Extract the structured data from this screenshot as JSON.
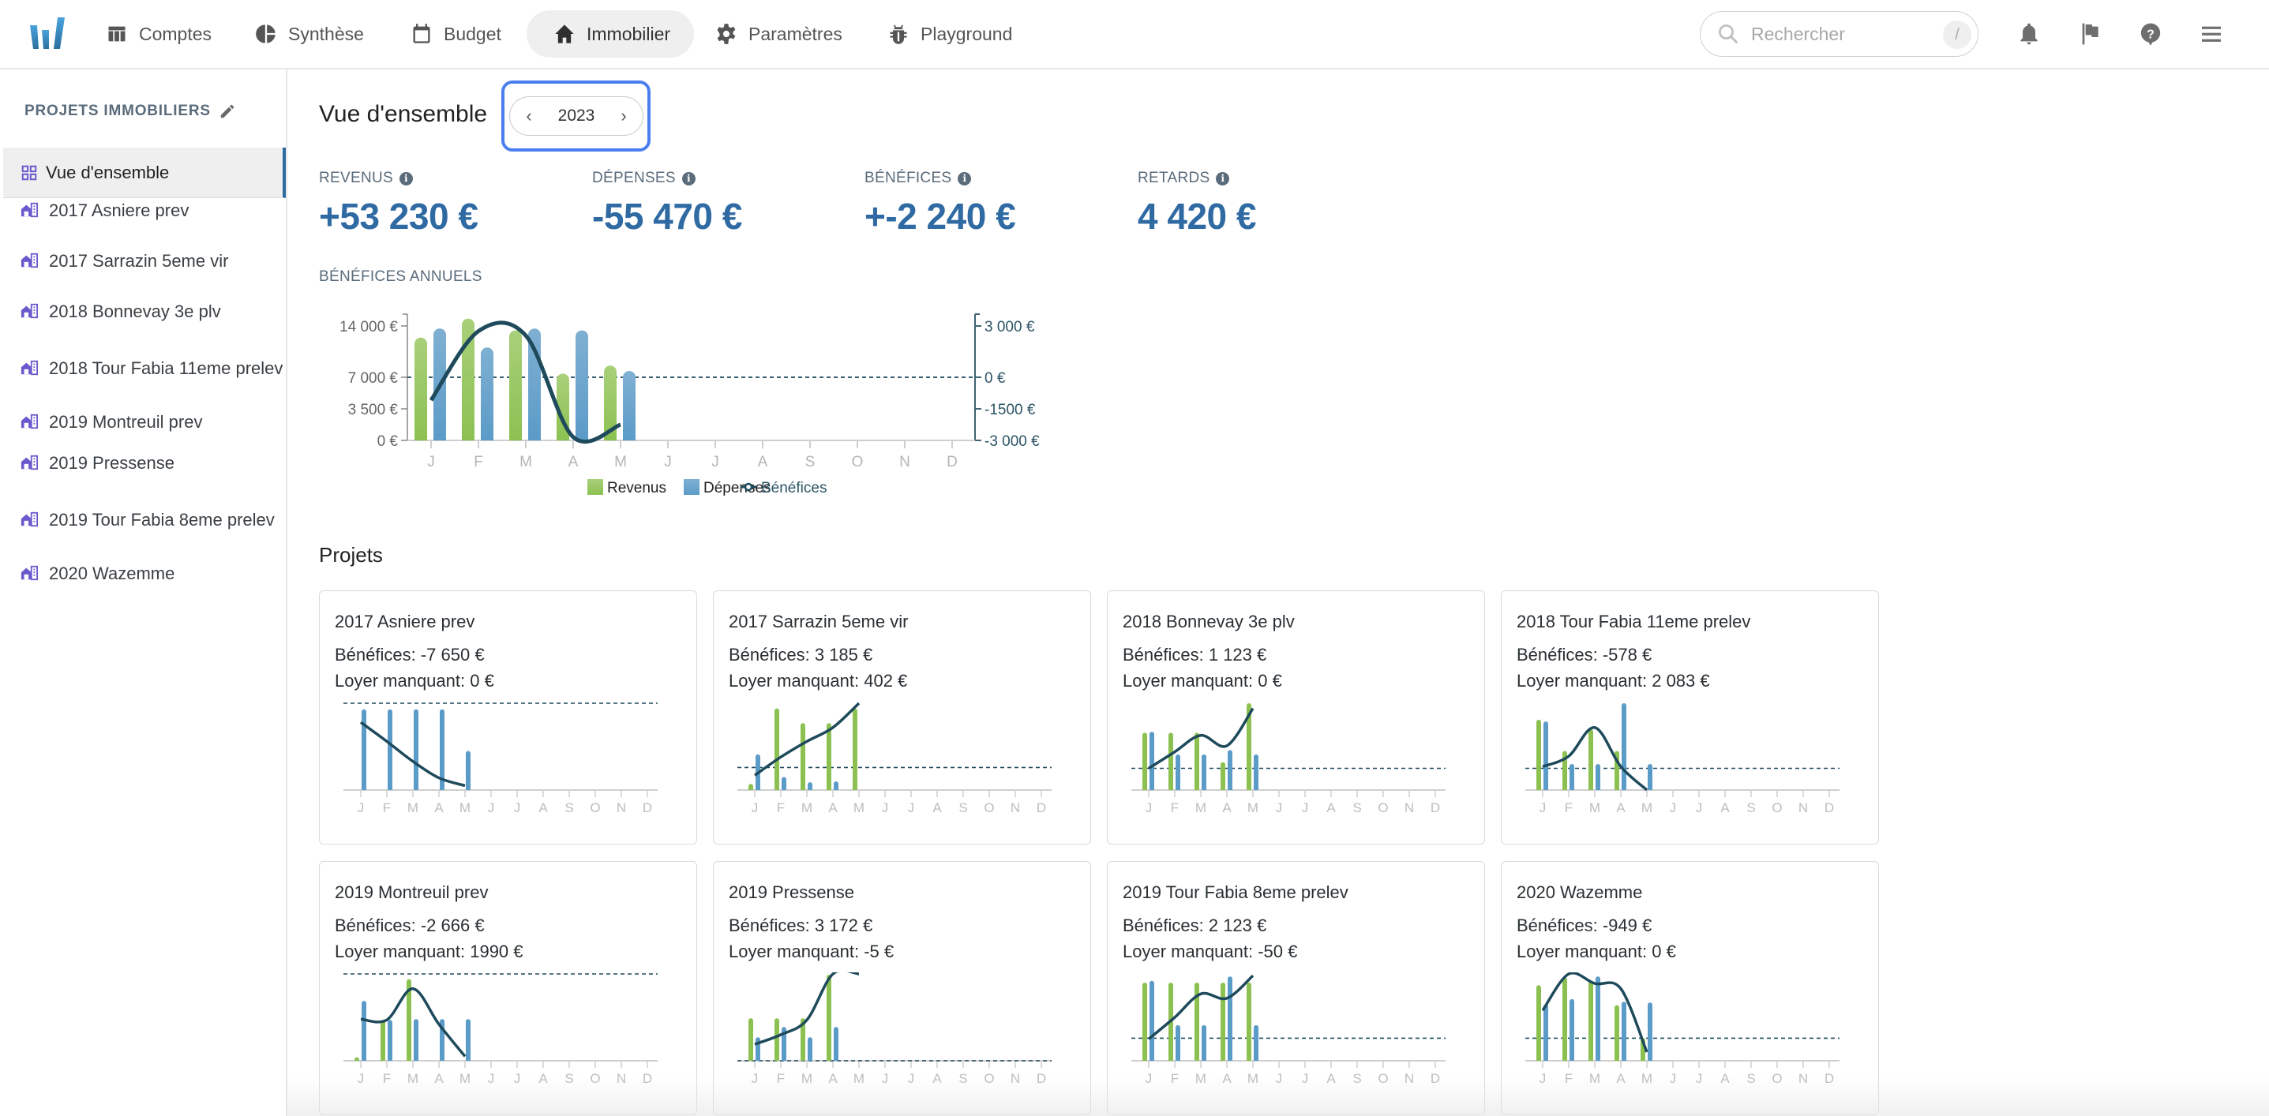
{
  "topbar": {
    "logo": "app-logo",
    "nav": [
      {
        "label": "Comptes",
        "icon": "table-icon",
        "active": false
      },
      {
        "label": "Synthèse",
        "icon": "pie-chart-icon",
        "active": false
      },
      {
        "label": "Budget",
        "icon": "calendar-icon",
        "active": false
      },
      {
        "label": "Immobilier",
        "icon": "home-icon",
        "active": true
      },
      {
        "label": "Paramètres",
        "icon": "gear-icon",
        "active": false
      },
      {
        "label": "Playground",
        "icon": "bug-icon",
        "active": false
      }
    ],
    "search": {
      "placeholder": "Rechercher",
      "value": "",
      "shortcut": "/"
    },
    "actions": [
      "bell-icon",
      "flag-icon",
      "help-icon",
      "menu-icon"
    ]
  },
  "sidebar": {
    "heading": "PROJETS IMMOBILIERS",
    "items": [
      {
        "label": "Vue d'ensemble",
        "icon": "grid-icon",
        "active": true
      },
      {
        "label": "2017 Asniere prev",
        "icon": "building-icon"
      },
      {
        "label": "2017 Sarrazin 5eme vir",
        "icon": "building-icon"
      },
      {
        "label": "2018 Bonnevay 3e plv",
        "icon": "building-icon"
      },
      {
        "label": "2018 Tour Fabia 11eme prelev",
        "icon": "building-icon"
      },
      {
        "label": "2019 Montreuil prev",
        "icon": "building-icon"
      },
      {
        "label": "2019 Pressense",
        "icon": "building-icon"
      },
      {
        "label": "2019 Tour Fabia 8eme prelev",
        "icon": "building-icon"
      },
      {
        "label": "2020 Wazemme",
        "icon": "building-icon"
      }
    ]
  },
  "main": {
    "title": "Vue d'ensemble",
    "year": "2023",
    "kpis": [
      {
        "label": "REVENUS",
        "value": "+53 230 €"
      },
      {
        "label": "DÉPENSES",
        "value": "-55 470 €"
      },
      {
        "label": "BÉNÉFICES",
        "value": "+-2 240 €"
      },
      {
        "label": "RETARDS",
        "value": "4 420 €"
      }
    ],
    "annual_label": "BÉNÉFICES ANNUELS",
    "projects_title": "Projets",
    "benefits_prefix": "Bénéfices: ",
    "missing_rent_prefix": "Loyer manquant: "
  },
  "colors": {
    "revenus": "#8cc152",
    "depenses": "#5b9bc8",
    "benefices": "#1e4a5c",
    "kpi_value": "#2f6aa3",
    "focus_ring": "#4a7ef0"
  },
  "chart_data": [
    {
      "type": "bar",
      "title": "BÉNÉFICES ANNUELS",
      "categories": [
        "J",
        "F",
        "M",
        "A",
        "M",
        "J",
        "J",
        "A",
        "S",
        "O",
        "N",
        "D"
      ],
      "series": [
        {
          "name": "Revenus",
          "axis": "left",
          "values": [
            11400,
            13500,
            12200,
            7400,
            8300,
            null,
            null,
            null,
            null,
            null,
            null,
            null
          ]
        },
        {
          "name": "Dépenses",
          "axis": "left",
          "values": [
            12400,
            10300,
            12400,
            12200,
            7700,
            null,
            null,
            null,
            null,
            null,
            null,
            null
          ]
        },
        {
          "name": "Bénéfices",
          "axis": "right",
          "type": "line",
          "values": [
            -1090,
            2190,
            1980,
            -2840,
            -2250,
            null,
            null,
            null,
            null,
            null,
            null,
            null
          ]
        }
      ],
      "left_axis": {
        "ylim": [
          0,
          14000
        ],
        "ticks": [
          0,
          3500,
          7000,
          14000
        ],
        "tick_labels": [
          "0 €",
          "3 500 €",
          "7 000 €",
          "14 000 €"
        ]
      },
      "right_axis": {
        "ylim": [
          -3000,
          3000
        ],
        "ticks": [
          -3000,
          -1500,
          0,
          3000
        ],
        "tick_labels": [
          "-3 000 €",
          "-1500 €",
          "0 €",
          "3 000 €"
        ]
      },
      "legend": [
        "Revenus",
        "Dépenses",
        "Bénéfices"
      ],
      "legend_position": "bottom",
      "xlabel": "",
      "ylabel": ""
    }
  ],
  "projects": [
    {
      "name": "2017 Asniere prev",
      "benefices": "-7 650 €",
      "loyer_manquant": "0 €",
      "chart": {
        "scale": "relative",
        "zero": 1.0,
        "revenus": [
          0,
          0,
          0,
          0,
          0
        ],
        "depenses": [
          0.93,
          0.93,
          0.93,
          0.93,
          0.45
        ],
        "benefices": [
          0.78,
          0.56,
          0.33,
          0.14,
          0.05
        ]
      }
    },
    {
      "name": "2017 Sarrazin 5eme vir",
      "benefices": "3 185 €",
      "loyer_manquant": "402 €",
      "chart": {
        "scale": "relative",
        "zero": 0.26,
        "revenus": [
          0.07,
          0.94,
          0.77,
          0.77,
          0.94
        ],
        "depenses": [
          0.41,
          0.15,
          0.09,
          0.1,
          0
        ],
        "benefices": [
          0.17,
          0.38,
          0.56,
          0.72,
          1.0
        ]
      }
    },
    {
      "name": "2018 Bonnevay 3e plv",
      "benefices": "1 123 €",
      "loyer_manquant": "0 €",
      "chart": {
        "scale": "relative",
        "zero": 0.25,
        "revenus": [
          0.66,
          0.66,
          0.66,
          0.32,
          1.0
        ],
        "depenses": [
          0.67,
          0.41,
          0.41,
          0.46,
          0.41
        ],
        "benefices": [
          0.25,
          0.44,
          0.63,
          0.51,
          0.94
        ]
      }
    },
    {
      "name": "2018 Tour Fabia 11eme prelev",
      "benefices": "-578 €",
      "loyer_manquant": "2 083 €",
      "chart": {
        "scale": "relative",
        "zero": 0.25,
        "revenus": [
          0.81,
          0.45,
          0.7,
          0.45,
          0
        ],
        "depenses": [
          0.79,
          0.3,
          0.3,
          1.0,
          0.3
        ],
        "benefices": [
          0.27,
          0.39,
          0.72,
          0.27,
          0.0
        ]
      }
    },
    {
      "name": "2019 Montreuil prev",
      "benefices": "-2 666 €",
      "loyer_manquant": "1990 €",
      "chart": {
        "scale": "relative",
        "zero": 1.0,
        "revenus": [
          0.04,
          0.47,
          0.94,
          0,
          0
        ],
        "depenses": [
          0.69,
          0.47,
          0.48,
          0.48,
          0.48
        ],
        "benefices": [
          0.48,
          0.47,
          0.83,
          0.42,
          0.05
        ]
      }
    },
    {
      "name": "2019 Pressense",
      "benefices": "3 172 €",
      "loyer_manquant": "-5 €",
      "chart": {
        "scale": "relative",
        "zero": 0.0,
        "revenus": [
          0.49,
          0.49,
          0.49,
          0.99,
          0
        ],
        "depenses": [
          0.27,
          0.39,
          0.27,
          0.39,
          0
        ],
        "benefices": [
          0.19,
          0.3,
          0.47,
          1.0,
          1.0
        ]
      }
    },
    {
      "name": "2019 Tour Fabia 8eme prelev",
      "benefices": "2 123 €",
      "loyer_manquant": "-50 €",
      "chart": {
        "scale": "relative",
        "zero": 0.26,
        "revenus": [
          0.9,
          0.9,
          0.9,
          0.9,
          0.9
        ],
        "depenses": [
          0.92,
          0.41,
          0.41,
          0.97,
          0.41
        ],
        "benefices": [
          0.25,
          0.5,
          0.77,
          0.72,
          0.98
        ]
      }
    },
    {
      "name": "2020 Wazemme",
      "benefices": "-949 €",
      "loyer_manquant": "0 €",
      "chart": {
        "scale": "relative",
        "zero": 0.26,
        "revenus": [
          0.87,
          0.96,
          0.92,
          0.64,
          0.26
        ],
        "depenses": [
          0.65,
          0.71,
          0.97,
          0.68,
          0.67
        ],
        "benefices": [
          0.58,
          1.0,
          0.89,
          0.83,
          0.1
        ]
      }
    }
  ],
  "months": [
    "J",
    "F",
    "M",
    "A",
    "M",
    "J",
    "J",
    "A",
    "S",
    "O",
    "N",
    "D"
  ]
}
